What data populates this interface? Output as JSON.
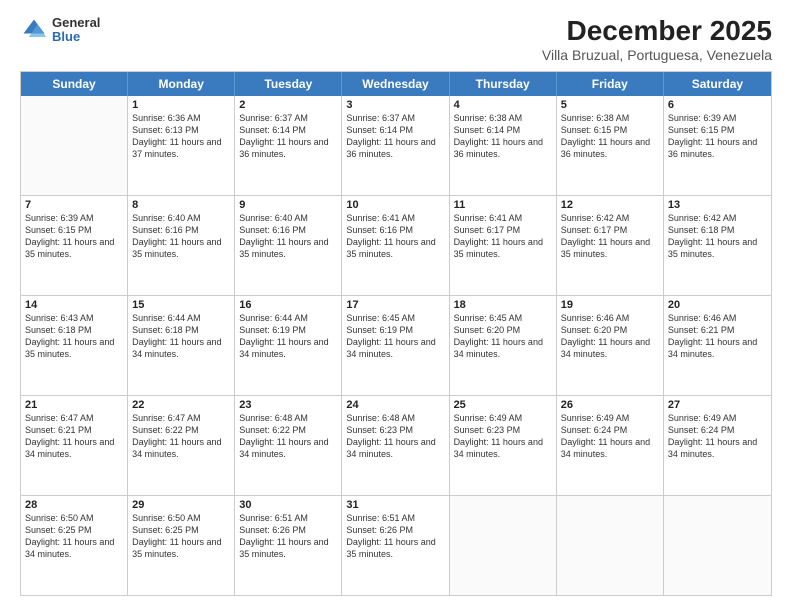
{
  "header": {
    "logo_general": "General",
    "logo_blue": "Blue",
    "title": "December 2025",
    "subtitle": "Villa Bruzual, Portuguesa, Venezuela"
  },
  "weekdays": [
    "Sunday",
    "Monday",
    "Tuesday",
    "Wednesday",
    "Thursday",
    "Friday",
    "Saturday"
  ],
  "weeks": [
    [
      {
        "day": "",
        "sunrise": "",
        "sunset": "",
        "daylight": ""
      },
      {
        "day": "1",
        "sunrise": "Sunrise: 6:36 AM",
        "sunset": "Sunset: 6:13 PM",
        "daylight": "Daylight: 11 hours and 37 minutes."
      },
      {
        "day": "2",
        "sunrise": "Sunrise: 6:37 AM",
        "sunset": "Sunset: 6:14 PM",
        "daylight": "Daylight: 11 hours and 36 minutes."
      },
      {
        "day": "3",
        "sunrise": "Sunrise: 6:37 AM",
        "sunset": "Sunset: 6:14 PM",
        "daylight": "Daylight: 11 hours and 36 minutes."
      },
      {
        "day": "4",
        "sunrise": "Sunrise: 6:38 AM",
        "sunset": "Sunset: 6:14 PM",
        "daylight": "Daylight: 11 hours and 36 minutes."
      },
      {
        "day": "5",
        "sunrise": "Sunrise: 6:38 AM",
        "sunset": "Sunset: 6:15 PM",
        "daylight": "Daylight: 11 hours and 36 minutes."
      },
      {
        "day": "6",
        "sunrise": "Sunrise: 6:39 AM",
        "sunset": "Sunset: 6:15 PM",
        "daylight": "Daylight: 11 hours and 36 minutes."
      }
    ],
    [
      {
        "day": "7",
        "sunrise": "Sunrise: 6:39 AM",
        "sunset": "Sunset: 6:15 PM",
        "daylight": "Daylight: 11 hours and 35 minutes."
      },
      {
        "day": "8",
        "sunrise": "Sunrise: 6:40 AM",
        "sunset": "Sunset: 6:16 PM",
        "daylight": "Daylight: 11 hours and 35 minutes."
      },
      {
        "day": "9",
        "sunrise": "Sunrise: 6:40 AM",
        "sunset": "Sunset: 6:16 PM",
        "daylight": "Daylight: 11 hours and 35 minutes."
      },
      {
        "day": "10",
        "sunrise": "Sunrise: 6:41 AM",
        "sunset": "Sunset: 6:16 PM",
        "daylight": "Daylight: 11 hours and 35 minutes."
      },
      {
        "day": "11",
        "sunrise": "Sunrise: 6:41 AM",
        "sunset": "Sunset: 6:17 PM",
        "daylight": "Daylight: 11 hours and 35 minutes."
      },
      {
        "day": "12",
        "sunrise": "Sunrise: 6:42 AM",
        "sunset": "Sunset: 6:17 PM",
        "daylight": "Daylight: 11 hours and 35 minutes."
      },
      {
        "day": "13",
        "sunrise": "Sunrise: 6:42 AM",
        "sunset": "Sunset: 6:18 PM",
        "daylight": "Daylight: 11 hours and 35 minutes."
      }
    ],
    [
      {
        "day": "14",
        "sunrise": "Sunrise: 6:43 AM",
        "sunset": "Sunset: 6:18 PM",
        "daylight": "Daylight: 11 hours and 35 minutes."
      },
      {
        "day": "15",
        "sunrise": "Sunrise: 6:44 AM",
        "sunset": "Sunset: 6:18 PM",
        "daylight": "Daylight: 11 hours and 34 minutes."
      },
      {
        "day": "16",
        "sunrise": "Sunrise: 6:44 AM",
        "sunset": "Sunset: 6:19 PM",
        "daylight": "Daylight: 11 hours and 34 minutes."
      },
      {
        "day": "17",
        "sunrise": "Sunrise: 6:45 AM",
        "sunset": "Sunset: 6:19 PM",
        "daylight": "Daylight: 11 hours and 34 minutes."
      },
      {
        "day": "18",
        "sunrise": "Sunrise: 6:45 AM",
        "sunset": "Sunset: 6:20 PM",
        "daylight": "Daylight: 11 hours and 34 minutes."
      },
      {
        "day": "19",
        "sunrise": "Sunrise: 6:46 AM",
        "sunset": "Sunset: 6:20 PM",
        "daylight": "Daylight: 11 hours and 34 minutes."
      },
      {
        "day": "20",
        "sunrise": "Sunrise: 6:46 AM",
        "sunset": "Sunset: 6:21 PM",
        "daylight": "Daylight: 11 hours and 34 minutes."
      }
    ],
    [
      {
        "day": "21",
        "sunrise": "Sunrise: 6:47 AM",
        "sunset": "Sunset: 6:21 PM",
        "daylight": "Daylight: 11 hours and 34 minutes."
      },
      {
        "day": "22",
        "sunrise": "Sunrise: 6:47 AM",
        "sunset": "Sunset: 6:22 PM",
        "daylight": "Daylight: 11 hours and 34 minutes."
      },
      {
        "day": "23",
        "sunrise": "Sunrise: 6:48 AM",
        "sunset": "Sunset: 6:22 PM",
        "daylight": "Daylight: 11 hours and 34 minutes."
      },
      {
        "day": "24",
        "sunrise": "Sunrise: 6:48 AM",
        "sunset": "Sunset: 6:23 PM",
        "daylight": "Daylight: 11 hours and 34 minutes."
      },
      {
        "day": "25",
        "sunrise": "Sunrise: 6:49 AM",
        "sunset": "Sunset: 6:23 PM",
        "daylight": "Daylight: 11 hours and 34 minutes."
      },
      {
        "day": "26",
        "sunrise": "Sunrise: 6:49 AM",
        "sunset": "Sunset: 6:24 PM",
        "daylight": "Daylight: 11 hours and 34 minutes."
      },
      {
        "day": "27",
        "sunrise": "Sunrise: 6:49 AM",
        "sunset": "Sunset: 6:24 PM",
        "daylight": "Daylight: 11 hours and 34 minutes."
      }
    ],
    [
      {
        "day": "28",
        "sunrise": "Sunrise: 6:50 AM",
        "sunset": "Sunset: 6:25 PM",
        "daylight": "Daylight: 11 hours and 34 minutes."
      },
      {
        "day": "29",
        "sunrise": "Sunrise: 6:50 AM",
        "sunset": "Sunset: 6:25 PM",
        "daylight": "Daylight: 11 hours and 35 minutes."
      },
      {
        "day": "30",
        "sunrise": "Sunrise: 6:51 AM",
        "sunset": "Sunset: 6:26 PM",
        "daylight": "Daylight: 11 hours and 35 minutes."
      },
      {
        "day": "31",
        "sunrise": "Sunrise: 6:51 AM",
        "sunset": "Sunset: 6:26 PM",
        "daylight": "Daylight: 11 hours and 35 minutes."
      },
      {
        "day": "",
        "sunrise": "",
        "sunset": "",
        "daylight": ""
      },
      {
        "day": "",
        "sunrise": "",
        "sunset": "",
        "daylight": ""
      },
      {
        "day": "",
        "sunrise": "",
        "sunset": "",
        "daylight": ""
      }
    ]
  ]
}
